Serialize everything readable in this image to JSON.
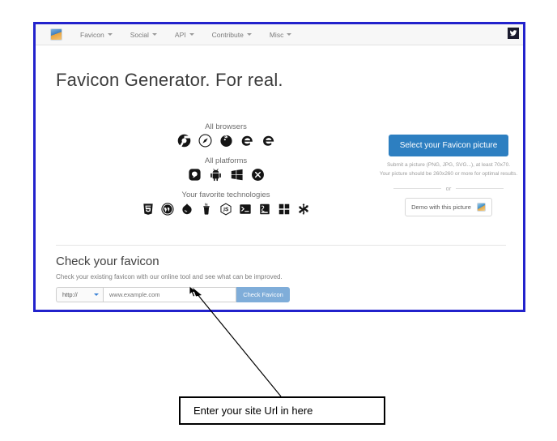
{
  "navbar": {
    "logo_icon": "favicon-logo-icon",
    "items": [
      {
        "label": "Favicon"
      },
      {
        "label": "Social"
      },
      {
        "label": "API"
      },
      {
        "label": "Contribute"
      },
      {
        "label": "Misc"
      }
    ],
    "twitter_icon": "twitter-bird-icon"
  },
  "hero": {
    "title": "Favicon Generator. For real."
  },
  "features": [
    {
      "caption": "All browsers",
      "icons": [
        "chrome-icon",
        "safari-icon",
        "firefox-icon",
        "edge-icon",
        "internet-explorer-icon"
      ]
    },
    {
      "caption": "All platforms",
      "icons": [
        "ios-icon",
        "android-icon",
        "windows-icon",
        "close-circle-icon"
      ]
    },
    {
      "caption": "Your favorite technologies",
      "icons": [
        "html5-icon",
        "wordpress-icon",
        "drupal-icon",
        "java-icon",
        "nodejs-icon",
        "terminal-icon",
        "laravel-icon",
        "metro-tiles-icon",
        "snowflake-icon"
      ]
    }
  ],
  "cta": {
    "select_button_label": "Select your Favicon picture",
    "note_line1": "Submit a picture (PNG, JPG, SVG...), at least 70x70.",
    "note_line2": "Your picture should be 260x260 or more for optimal results.",
    "or_label": "or",
    "demo_button_label": "Demo with this picture",
    "demo_thumb_icon": "demo-picture-thumbnail",
    "accent_color": "#2d7fc1"
  },
  "check_section": {
    "title": "Check your favicon",
    "subtitle": "Check your existing favicon with our online tool and see what can be improved.",
    "protocol_value": "http://",
    "url_placeholder": "www.example.com",
    "url_value": "",
    "check_button_label": "Check Favicon",
    "check_button_color": "#7fadd9"
  },
  "annotation": {
    "callout_text": "Enter your site Url in here",
    "arrow_icon": "annotation-arrow-icon"
  },
  "cursor": {
    "icon": "mouse-pointer-icon"
  }
}
